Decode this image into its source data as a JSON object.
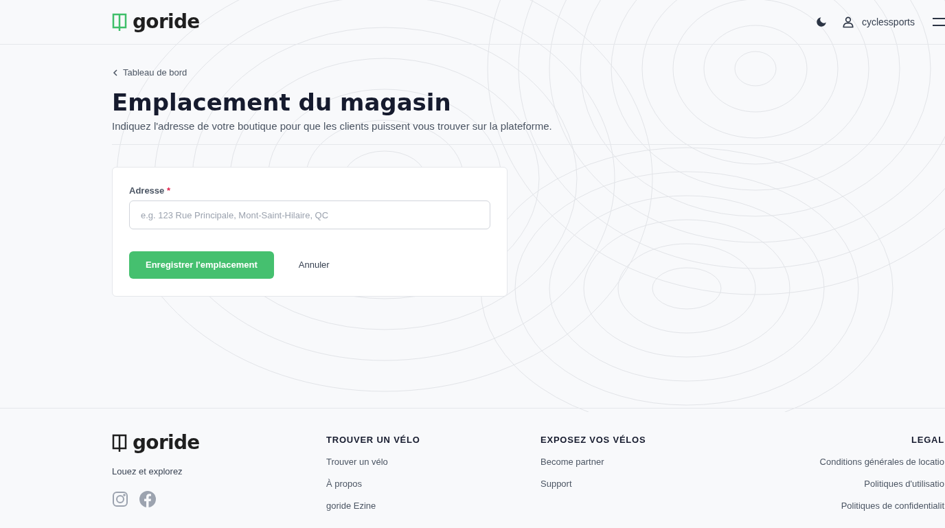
{
  "header": {
    "logo": "goride",
    "username": "cyclessports"
  },
  "breadcrumb": "Tableau de bord",
  "page": {
    "title": "Emplacement du magasin",
    "subtitle": "Indiquez l'adresse de votre boutique pour que les clients puissent vous trouver sur la plateforme."
  },
  "form": {
    "label": "Adresse",
    "required_mark": "*",
    "placeholder": "e.g. 123 Rue Principale, Mont-Saint-Hilaire, QC",
    "submit": "Enregistrer l'emplacement",
    "cancel": "Annuler"
  },
  "footer": {
    "logo": "goride",
    "tagline": "Louez et explorez",
    "columns": [
      {
        "heading": "TROUVER UN VÉLO",
        "links": [
          "Trouver un vélo",
          "À propos",
          "goride Ezine"
        ]
      },
      {
        "heading": "EXPOSEZ VOS VÉLOS",
        "links": [
          "Become partner",
          "Support"
        ]
      },
      {
        "heading": "LEGAL",
        "links": [
          "Conditions générales de locatio",
          "Politiques d'utilisatio",
          "Politiques de confidentialit"
        ]
      }
    ]
  }
}
